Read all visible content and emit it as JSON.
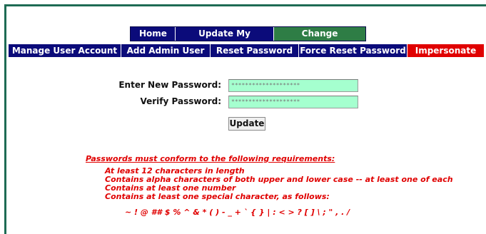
{
  "top_nav": {
    "tabs": [
      {
        "label": "Home",
        "active": false
      },
      {
        "label": "Update My Account",
        "active": false
      },
      {
        "label": "Change Password",
        "active": true
      }
    ]
  },
  "sub_nav": {
    "items": [
      {
        "label": "Manage User Account"
      },
      {
        "label": "Add Admin User"
      },
      {
        "label": "Reset Password"
      },
      {
        "label": "Force Reset Password"
      },
      {
        "label": "Impersonate"
      }
    ]
  },
  "form": {
    "new_password_label": "Enter New Password:",
    "new_password_value": "********************",
    "verify_password_label": "Verify Password:",
    "verify_password_value": "********************",
    "update_label": "Update"
  },
  "requirements": {
    "heading": "Passwords must conform to the following requirements:",
    "items": [
      "At least 12 characters in length",
      "Contains alpha characters of both upper and lower case -- at least one of each",
      "Contains at least one number",
      "Contains at least one special character, as follows:"
    ],
    "special_chars": "~ ! @ ## $ % ^ & * ( ) - _ + ` { } | : < > ? [ ] \\ ; \" , . /"
  },
  "colors": {
    "frame_border": "#1e6b54",
    "nav_bg": "#0b0b7a",
    "active_tab": "#2e7d45",
    "danger": "#e00000",
    "input_bg": "#a5ffcf",
    "requirement_text": "#e00000"
  }
}
